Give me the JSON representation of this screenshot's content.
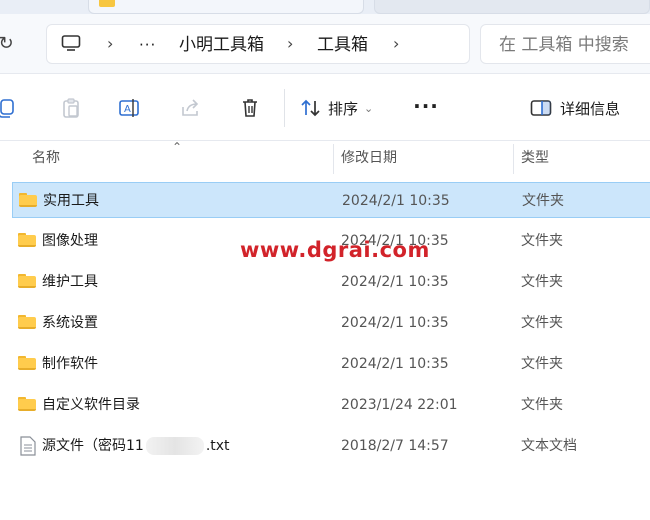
{
  "window": {
    "breadcrumb": [
      "小明工具箱",
      "工具箱"
    ],
    "overflow_label": "···",
    "search_placeholder": "在 工具箱 中搜索"
  },
  "commandbar": {
    "sort_label": "排序",
    "more_label": "···",
    "details_label": "详细信息",
    "icons": [
      "copy-icon",
      "paste-icon",
      "rename-icon",
      "share-icon",
      "delete-icon",
      "sort-icon",
      "details-pane-icon"
    ]
  },
  "columns": {
    "name": "名称",
    "modified": "修改日期",
    "type": "类型"
  },
  "files": [
    {
      "name": "实用工具",
      "date": "2024/2/1 10:35",
      "type": "文件夹",
      "icon": "folder-icon",
      "selected": true
    },
    {
      "name": "图像处理",
      "date": "2024/2/1 10:35",
      "type": "文件夹",
      "icon": "folder-icon",
      "selected": false
    },
    {
      "name": "维护工具",
      "date": "2024/2/1 10:35",
      "type": "文件夹",
      "icon": "folder-icon",
      "selected": false
    },
    {
      "name": "系统设置",
      "date": "2024/2/1 10:35",
      "type": "文件夹",
      "icon": "folder-icon",
      "selected": false
    },
    {
      "name": "制作软件",
      "date": "2024/2/1 10:35",
      "type": "文件夹",
      "icon": "folder-icon",
      "selected": false
    },
    {
      "name": "自定义软件目录",
      "date": "2023/1/24 22:01",
      "type": "文件夹",
      "icon": "folder-icon",
      "selected": false
    },
    {
      "name_prefix": "源文件（密码11",
      "name_suffix": ".txt",
      "date": "2018/2/7 14:57",
      "type": "文本文档",
      "icon": "text-file-icon",
      "selected": false
    }
  ],
  "watermark": "www.dgrai.com",
  "colors": {
    "selection": "#cce6fb",
    "selection_border": "#99cdf5",
    "folder": "#ffcc4d",
    "watermark": "#d2232a"
  }
}
